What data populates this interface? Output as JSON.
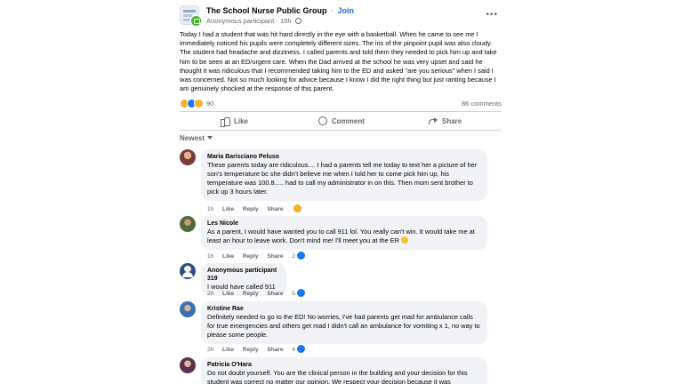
{
  "post": {
    "group_name": "The School Nurse Public Group",
    "separator": "·",
    "join_label": "Join",
    "author": "Anonymous participant",
    "time": "15h",
    "more": "•••",
    "body": "Today I had a student that was hit hard directly in the eye with a basketball.  When he came to see me I immediately noticed his pupils were completely different sizes.  The iris of the pinpoint pupil was also cloudy.  The student had headache and dizziness.  I called parents and told them they needed to pick him up and take him to be seen at an ED/urgent care.  When the Dad arrived at the school he was very upset and said he thought it was ridiculous that I recommended taking him to the ED and asked \"are you serious\" when I said I was concerned.  Not so much looking for advice because I know I did the right thing but just ranting because I am genuinely shocked at the response of this parent.",
    "reaction_count": "90",
    "comment_count": "86 comments"
  },
  "actions": {
    "like": "Like",
    "comment": "Comment",
    "share": "Share"
  },
  "sort_label": "Newest",
  "comments": [
    {
      "name": "Maria Barisciano Peluso",
      "text": "These parents today are ridiculous.... I had a parents tell me today to text her a picture of her son's temperature bc she didn't believe me when I told her to come pick him up, his temperature was 100.8..... had to call my administrator in on this. Then mom sent brother to pick up 3 hours later.",
      "time": "1h",
      "like": "Like",
      "reply": "Reply",
      "share": "Share",
      "reacts": ""
    },
    {
      "name": "Les Nicole",
      "text": "As a parent, I would have wanted you to call 911 lol. You really can't win. It would take me at least an hour to leave work. Don't mind me! I'll meet you at the ER",
      "time": "1h",
      "like": "Like",
      "reply": "Reply",
      "share": "Share",
      "reacts": "2"
    },
    {
      "name": "Anonymous participant 319",
      "text": "I would have called 911",
      "time": "2h",
      "like": "Like",
      "reply": "Reply",
      "share": "Share",
      "reacts": "5"
    },
    {
      "name": "Kristine Rae",
      "text": "Definitely needed to go to the ED! No worries, I've had parents get mad for ambulance calls for true emergencies and others get mad I didn't call an ambulance for vomiting x 1, no way to please some people.",
      "time": "2h",
      "like": "Like",
      "reply": "Reply",
      "share": "Share",
      "reacts": "4"
    },
    {
      "name": "Patricia O'Hara",
      "text": "Do not doubt yourself. You are the clinical person in the building and your decision for this student was correct no matter our opinion. We respect your decision because it was",
      "time": "",
      "like": "",
      "reply": "",
      "share": "",
      "reacts": ""
    }
  ],
  "colors": {
    "accent": "#216fdb",
    "bubble": "#f0f2f5",
    "muted": "#65676b"
  }
}
